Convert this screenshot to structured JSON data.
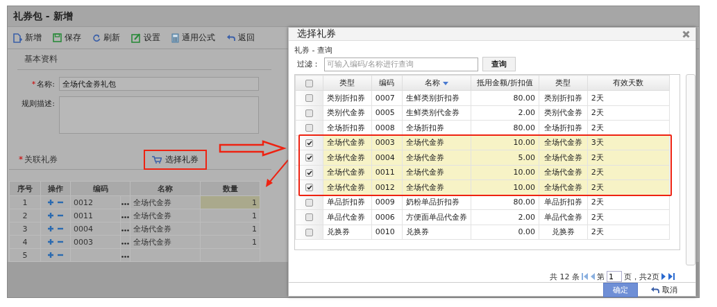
{
  "main": {
    "title": "礼券包 - 新增",
    "toolbar": [
      {
        "label": "新增",
        "kind": "new"
      },
      {
        "label": "保存",
        "kind": "save"
      },
      {
        "label": "刷新",
        "kind": "refresh"
      },
      {
        "label": "设置",
        "kind": "edit"
      },
      {
        "label": "通用公式",
        "kind": "formula"
      },
      {
        "label": "返回",
        "kind": "back"
      }
    ],
    "section": "基本资料",
    "name_field": {
      "required_mark": "*",
      "label": "名称:",
      "value": "全场代金券礼包"
    },
    "description_field": {
      "label": "规则描述:"
    },
    "linked": {
      "required_mark": "*",
      "label": "关联礼券",
      "select_button": "选择礼券"
    },
    "grid": {
      "columns": [
        "序号",
        "操作",
        "编码",
        "名称",
        "数量"
      ],
      "rows": [
        {
          "index": "1",
          "code": "0012",
          "name": "全场代金券",
          "quantity": "1",
          "selected": true
        },
        {
          "index": "2",
          "code": "0011",
          "name": "全场代金券",
          "quantity": "1",
          "selected": false
        },
        {
          "index": "3",
          "code": "0004",
          "name": "全场代金券",
          "quantity": "1",
          "selected": false
        },
        {
          "index": "4",
          "code": "0003",
          "name": "全场代金券",
          "quantity": "1",
          "selected": false
        },
        {
          "index": "5",
          "selected": false
        }
      ]
    }
  },
  "dialog": {
    "title": "选择礼券",
    "query_label": "礼券 - 查询",
    "filter": {
      "label": "过滤：",
      "placeholder": "可输入编码/名称进行查询"
    },
    "search_button": "查询",
    "columns": [
      {
        "label": "类型",
        "sorted": false
      },
      {
        "label": "编码",
        "sorted": false
      },
      {
        "label": "名称",
        "sorted": true
      },
      {
        "label": "抵用金额/折扣值",
        "sorted": false
      },
      {
        "label": "类型",
        "sorted": false
      },
      {
        "label": "有效天数",
        "sorted": false
      }
    ],
    "all_checked": false,
    "rows": [
      {
        "type": "类别折扣券",
        "code": "0007",
        "name": "生鲜类别折扣券",
        "value": "80.00",
        "type2": "类别折扣券",
        "days": "2天",
        "checked": false
      },
      {
        "type": "类别代金券",
        "code": "0005",
        "name": "生鲜类别代金券",
        "value": "2.00",
        "type2": "类别代金券",
        "days": "2天",
        "checked": false
      },
      {
        "type": "全场折扣券",
        "code": "0008",
        "name": "全场折扣券",
        "value": "80.00",
        "type2": "全场折扣券",
        "days": "2天",
        "checked": false
      },
      {
        "type": "全场代金券",
        "code": "0003",
        "name": "全场代金券",
        "value": "10.00",
        "type2": "全场代金券",
        "days": "3天",
        "checked": true
      },
      {
        "type": "全场代金券",
        "code": "0004",
        "name": "全场代金券",
        "value": "5.00",
        "type2": "全场代金券",
        "days": "2天",
        "checked": true
      },
      {
        "type": "全场代金券",
        "code": "0011",
        "name": "全场代金券",
        "value": "10.00",
        "type2": "全场代金券",
        "days": "2天",
        "checked": true
      },
      {
        "type": "全场代金券",
        "code": "0012",
        "name": "全场代金券",
        "value": "10.00",
        "type2": "全场代金券",
        "days": "2天",
        "checked": true
      },
      {
        "type": "单品折扣券",
        "code": "0009",
        "name": "奶粉单品折扣券",
        "value": "80.00",
        "type2": "单品折扣券",
        "days": "2天",
        "checked": false
      },
      {
        "type": "单品代金券",
        "code": "0006",
        "name": "方便面单品代金券",
        "value": "2.00",
        "type2": "单品代金券",
        "days": "2天",
        "checked": false
      },
      {
        "type": "兑换券",
        "code": "0010",
        "name": "兑换券",
        "value": "0.00",
        "type2": "兑换券",
        "days": "2天",
        "checked": false
      }
    ],
    "pager": {
      "total": "共 12 条",
      "page_prefix": "第",
      "page": "1",
      "page_suffix": "页，共2页"
    },
    "confirm_button": "确定",
    "cancel_button": "取消"
  }
}
